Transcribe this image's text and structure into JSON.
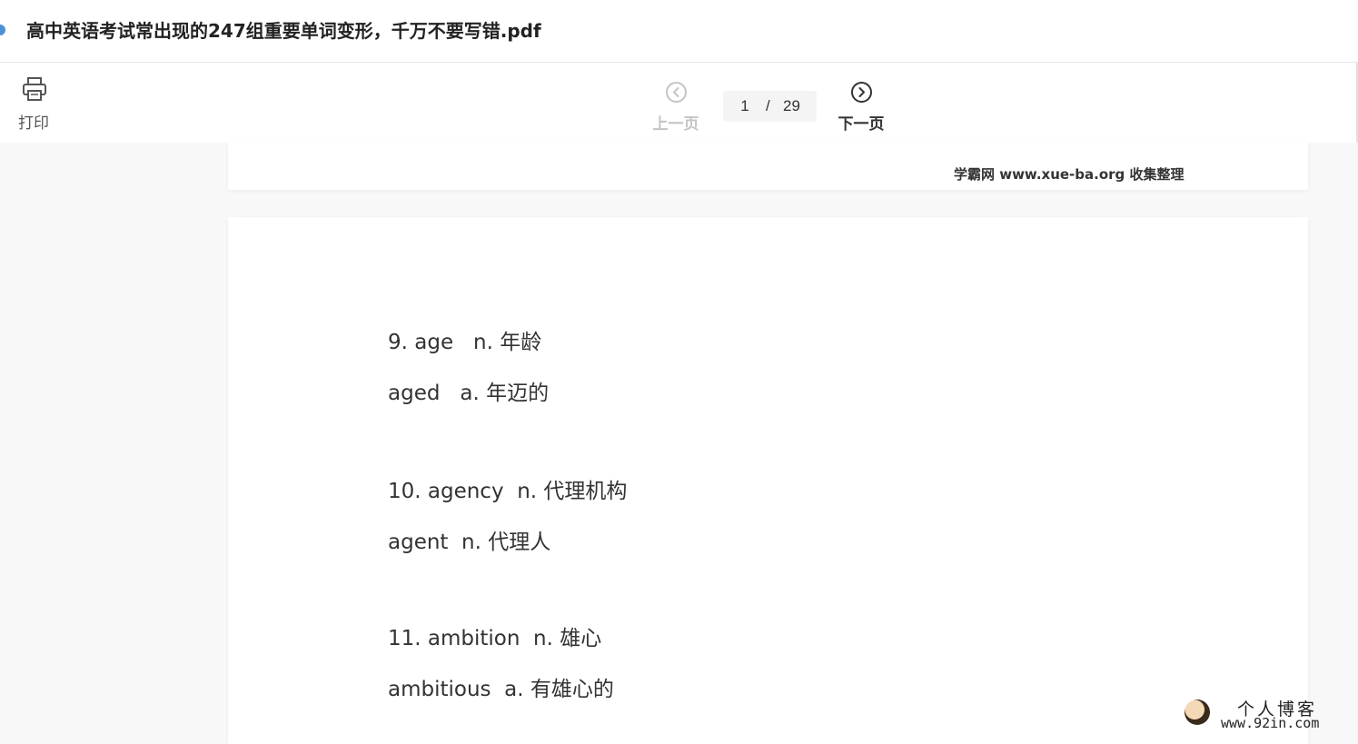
{
  "window": {
    "title": "高中英语考试常出现的247组重要单词变形，千万不要写错.pdf"
  },
  "toolbar": {
    "print_label": "打印",
    "print_icon": "printer-icon",
    "prev_label": "上一页",
    "prev_icon": "chevron-left-circle-icon",
    "next_label": "下一页",
    "next_icon": "chevron-right-circle-icon",
    "page_current": "1",
    "page_separator": "/",
    "page_total": "29"
  },
  "document": {
    "prev_page_footer": "学霸网 www.xue-ba.org 收集整理",
    "lines": [
      "9. age   n. 年龄",
      "aged   a. 年迈的",
      "10. agency  n. 代理机构",
      "agent  n. 代理人",
      "11. ambition  n. 雄心",
      "ambitious  a. 有雄心的"
    ]
  },
  "badge": {
    "title": "个人博客",
    "url": "www.92in.com"
  },
  "colors": {
    "background": "#f8f8f8",
    "page": "#ffffff",
    "disabled_text": "#c4c4c4",
    "text": "#333333"
  }
}
